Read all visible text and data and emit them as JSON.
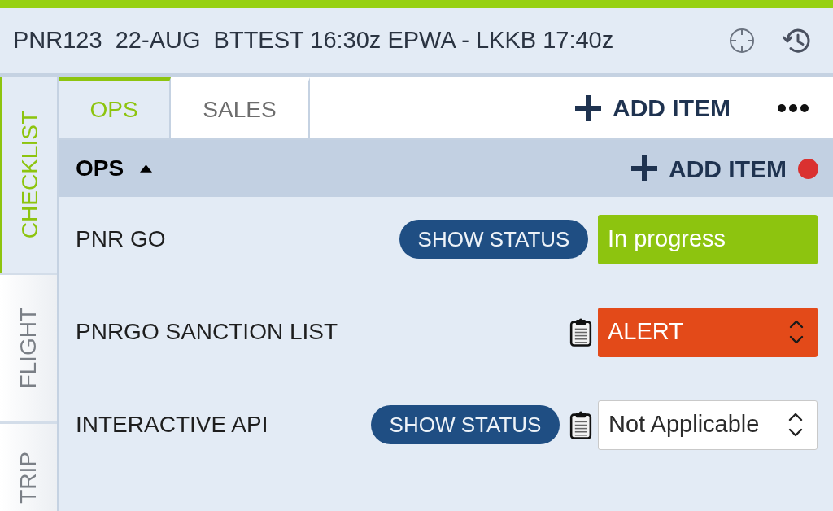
{
  "header": {
    "title": "PNR123  22-AUG  BTTEST 16:30z EPWA - LKKB 17:40z"
  },
  "side_tabs": [
    {
      "label": "CHECKLIST",
      "selected": true
    },
    {
      "label": "FLIGHT",
      "selected": false
    },
    {
      "label": "TRIP",
      "selected": false
    }
  ],
  "tabs": [
    {
      "label": "OPS",
      "selected": true
    },
    {
      "label": "SALES",
      "selected": false
    }
  ],
  "toolbar": {
    "add_item": "ADD ITEM"
  },
  "section": {
    "title": "OPS",
    "expanded": true,
    "add_item": "ADD ITEM",
    "alert": true
  },
  "items": [
    {
      "name": "PNR GO",
      "action": "SHOW STATUS",
      "note": false,
      "kind": "status",
      "value": "In progress",
      "color": "#8dc40f"
    },
    {
      "name": "PNRGO SANCTION LIST",
      "note": true,
      "kind": "select",
      "value": "ALERT",
      "color": "#e34a19"
    },
    {
      "name": "INTERACTIVE API",
      "action": "SHOW STATUS",
      "note": true,
      "kind": "select",
      "value": "Not Applicable",
      "color": "#ffffff"
    }
  ]
}
